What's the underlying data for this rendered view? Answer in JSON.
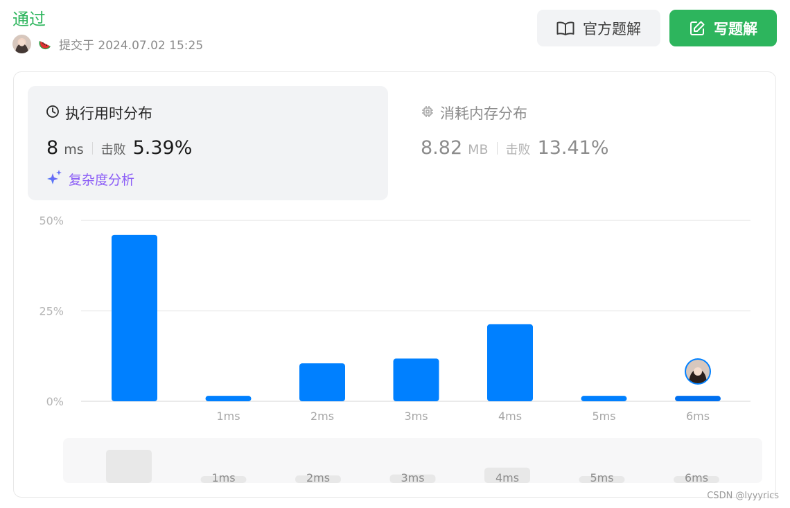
{
  "header": {
    "status": "通过",
    "submit_text": "提交于 2024.07.02 15:25",
    "avatar_icon": "user-avatar",
    "badge_icon": "watermelon-icon"
  },
  "buttons": {
    "official_solution": "官方题解",
    "write_solution": "写题解",
    "official_icon": "book-open-icon",
    "write_icon": "edit-icon"
  },
  "runtime": {
    "title": "执行用时分布",
    "icon": "clock-icon",
    "value": "8",
    "unit": "ms",
    "beats_label": "击败",
    "beats_pct": "5.39%",
    "complexity_link": "复杂度分析",
    "complexity_icon": "sparkle-icon"
  },
  "memory": {
    "title": "消耗内存分布",
    "icon": "cpu-chip-icon",
    "value": "8.82",
    "unit": "MB",
    "beats_label": "击败",
    "beats_pct": "13.41%"
  },
  "chart_data": {
    "type": "bar",
    "title": "",
    "xlabel": "",
    "ylabel": "",
    "categories": [
      "",
      "1ms",
      "2ms",
      "3ms",
      "4ms",
      "5ms",
      "6ms"
    ],
    "values": [
      46,
      1.5,
      10.5,
      11.8,
      21.3,
      1.5,
      1.5
    ],
    "ylim": [
      0,
      50
    ],
    "yticks": [
      "0%",
      "25%",
      "50%"
    ],
    "ytick_values": [
      0,
      25,
      50
    ],
    "highlight_index": 6,
    "grid": true,
    "overview_labels": [
      "",
      "1ms",
      "2ms",
      "3ms",
      "4ms",
      "5ms",
      "6ms"
    ],
    "colors": {
      "bar": "#0080ff",
      "bar_highlight": "#0070f0",
      "overview_bar": "#e8e8e8"
    }
  },
  "watermark": "CSDN @lyyyrics"
}
